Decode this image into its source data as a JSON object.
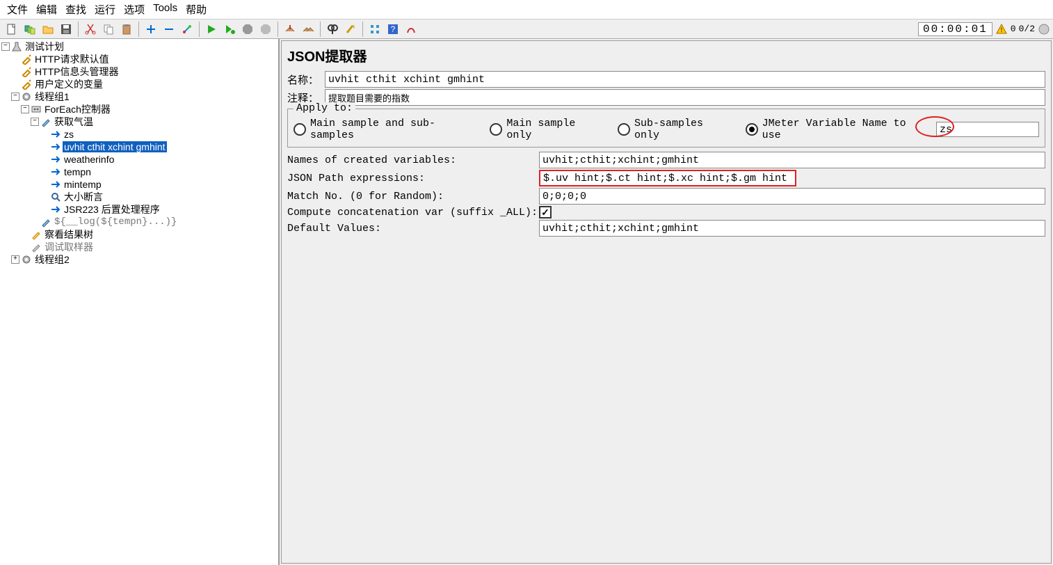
{
  "menu": [
    "文件",
    "编辑",
    "查找",
    "运行",
    "选项",
    "Tools",
    "帮助"
  ],
  "toolbar_right": {
    "timer": "00:00:01",
    "warn_count": "0",
    "ratio": "0/2"
  },
  "tree": {
    "root": "测试计划",
    "http_defaults": "HTTP请求默认值",
    "http_header": "HTTP信息头管理器",
    "user_vars": "用户定义的变量",
    "thread1": "线程组1",
    "foreach": "ForEach控制器",
    "get_temp": "获取气温",
    "zs": "zs",
    "selected": "uvhit cthit xchint gmhint",
    "weatherinfo": "weatherinfo",
    "tempn": "tempn",
    "mintemp": "mintemp",
    "size_assert": "大小断言",
    "jsr223": "JSR223 后置处理程序",
    "log_expr": "${__log(${tempn}...)}",
    "view_tree": "察看结果树",
    "debug": "调试取样器",
    "thread2": "线程组2"
  },
  "panel": {
    "title": "JSON提取器",
    "name_label": "名称：",
    "name_value": "uvhit cthit xchint gmhint",
    "comment_label": "注释：",
    "comment_value": "提取题目需要的指数",
    "apply_legend": "Apply to:",
    "radio0": "Main sample and sub-samples",
    "radio1": "Main sample only",
    "radio2": "Sub-samples only",
    "radio3": "JMeter Variable Name to use",
    "var_name": "zs",
    "f_names_label": "Names of created variables:",
    "f_names_value": "uvhit;cthit;xchint;gmhint",
    "f_json_label": "JSON Path expressions:",
    "f_json_value": "$.uv hint;$.ct hint;$.xc hint;$.gm hint",
    "f_match_label": "Match No. (0 for Random):",
    "f_match_value": "0;0;0;0",
    "f_concat_label": "Compute concatenation var (suffix _ALL):",
    "f_default_label": "Default Values:",
    "f_default_value": "uvhit;cthit;xchint;gmhint",
    "checkmark": "✓"
  }
}
